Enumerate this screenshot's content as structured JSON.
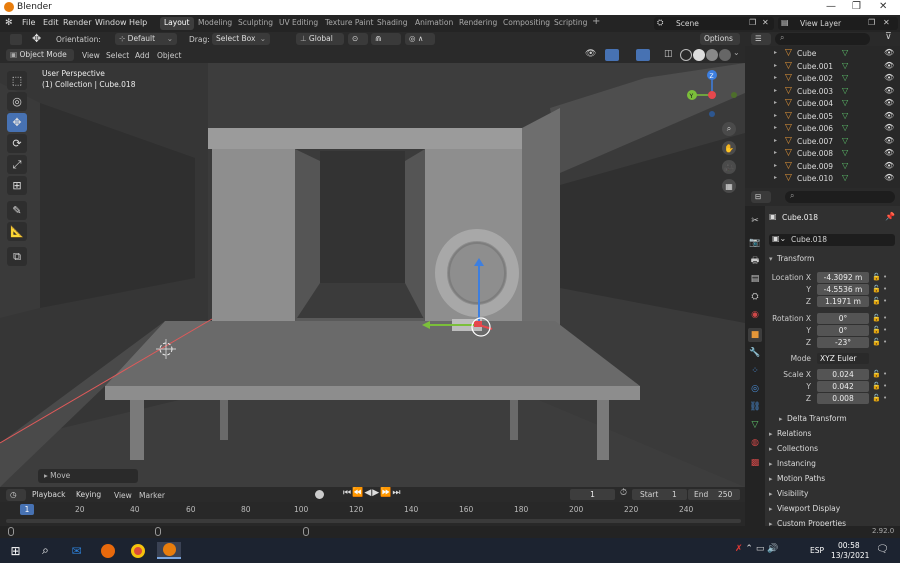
{
  "window": {
    "title": "Blender"
  },
  "menu": [
    "File",
    "Edit",
    "Render",
    "Window",
    "Help"
  ],
  "workspaces": [
    "Layout",
    "Modeling",
    "Sculpting",
    "UV Editing",
    "Texture Paint",
    "Shading",
    "Animation",
    "Rendering",
    "Compositing",
    "Scripting"
  ],
  "active_workspace": "Layout",
  "scene": {
    "name": "Scene",
    "view_layer": "View Layer"
  },
  "toolbar": {
    "orientation_label": "Orientation:",
    "orientation_value": "Default",
    "drag_label": "Drag:",
    "drag_value": "Select Box",
    "transform_orientation": "Global",
    "options_label": "Options"
  },
  "mode_header": {
    "mode": "Object Mode",
    "menus": [
      "View",
      "Select",
      "Add",
      "Object"
    ]
  },
  "viewport": {
    "view_name": "User Perspective",
    "collection_info": "(1) Collection | Cube.018",
    "last_op": "Move",
    "gizmo_axes": {
      "z": "Z",
      "y": "Y"
    }
  },
  "timeline": {
    "menus": [
      "Playback",
      "Keying",
      "View",
      "Marker"
    ],
    "current_frame": "1",
    "start_label": "Start",
    "start": "1",
    "end_label": "End",
    "end": "250",
    "ruler": [
      "20",
      "40",
      "60",
      "80",
      "100",
      "120",
      "140",
      "160",
      "180",
      "200",
      "220",
      "240"
    ],
    "cursor_frame": "1"
  },
  "outliner": {
    "items": [
      "Cube",
      "Cube.001",
      "Cube.002",
      "Cube.003",
      "Cube.004",
      "Cube.005",
      "Cube.006",
      "Cube.007",
      "Cube.008",
      "Cube.009",
      "Cube.010"
    ]
  },
  "properties": {
    "object_name": "Cube.018",
    "data_name": "Cube.018",
    "transform_title": "Transform",
    "location_label": "Location X",
    "location": [
      "-4.3092 m",
      "-4.5536 m",
      "1.1971 m"
    ],
    "rotation_label": "Rotation X",
    "rotation": [
      "0°",
      "0°",
      "-23°"
    ],
    "mode_label": "Mode",
    "mode_value": "XYZ Euler",
    "scale_label": "Scale X",
    "scale": [
      "0.024",
      "0.042",
      "0.008"
    ],
    "axis_y": "Y",
    "axis_z": "Z",
    "panels": [
      "Delta Transform",
      "Relations",
      "Collections",
      "Instancing",
      "Motion Paths",
      "Visibility",
      "Viewport Display",
      "Custom Properties"
    ]
  },
  "status": {
    "version": "2.92.0"
  },
  "taskbar": {
    "lang": "ESP",
    "time": "00:58",
    "date": "13/3/2021"
  },
  "colors": {
    "accent": "#4772b3",
    "object_orange": "#e49638",
    "mesh_green": "#5ec46c",
    "axis_x": "#e5484d",
    "axis_y": "#7bbf3a",
    "axis_z": "#3d7fe0"
  }
}
